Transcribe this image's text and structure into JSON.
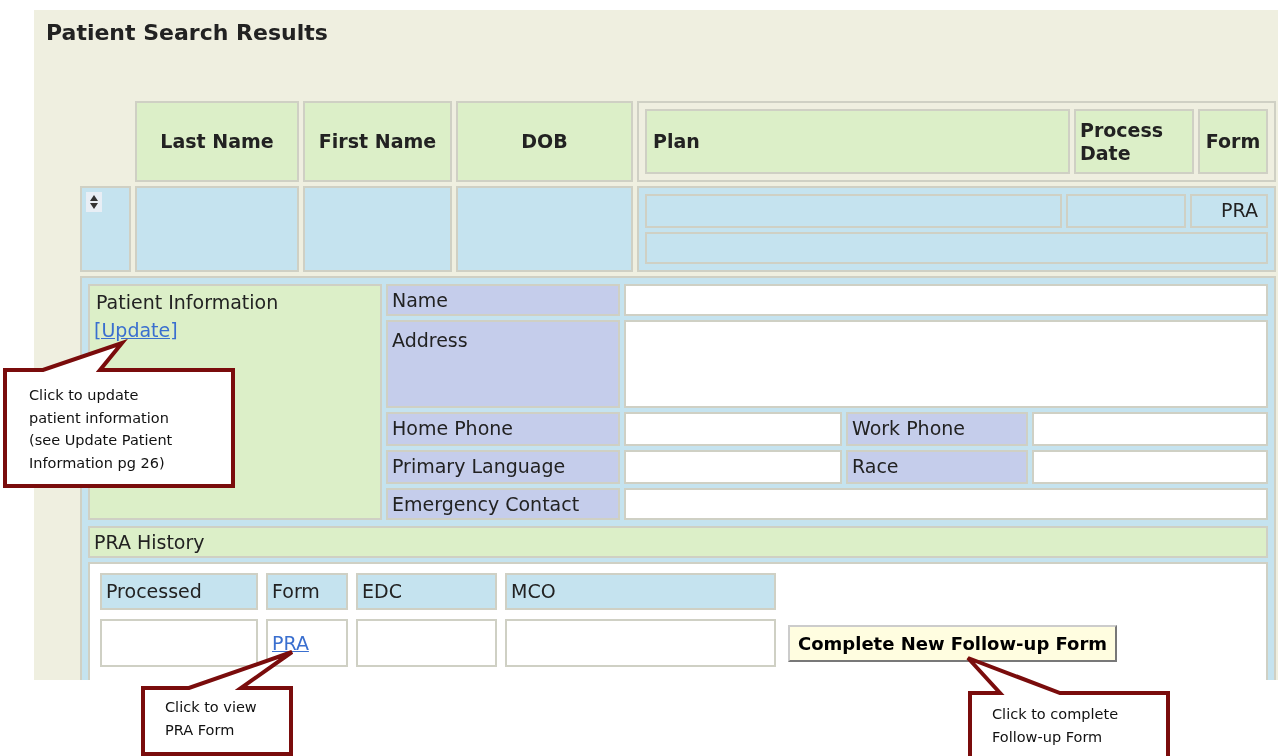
{
  "title": "Patient Search Results",
  "results_table": {
    "columns": [
      "Last Name",
      "First Name",
      "DOB"
    ],
    "plan_columns": [
      "Plan",
      "Process Date",
      "Form"
    ],
    "rows": [
      {
        "form": "PRA"
      }
    ]
  },
  "patient_panel": {
    "heading": "Patient Information",
    "update_link": "[Update]",
    "rows": [
      {
        "kind": "single",
        "labels": [
          "Name"
        ]
      },
      {
        "kind": "tall",
        "labels": [
          "Address"
        ]
      },
      {
        "kind": "pair",
        "labels": [
          "Home Phone",
          "Work Phone"
        ]
      },
      {
        "kind": "pair",
        "labels": [
          "Primary Language",
          "Race"
        ]
      },
      {
        "kind": "single",
        "labels": [
          "Emergency Contact"
        ]
      }
    ]
  },
  "history": {
    "heading": "PRA History",
    "columns": [
      "Processed",
      "Form",
      "EDC",
      "MCO"
    ],
    "rows": [
      {
        "form_link": "PRA"
      }
    ],
    "button": "Complete New Follow-up Form"
  },
  "callouts": [
    {
      "lines": [
        "Click to update",
        "patient information",
        "(see Update Patient",
        "Information pg 26)"
      ]
    },
    {
      "lines": [
        "Click to view",
        "PRA Form"
      ]
    },
    {
      "lines": [
        "Click to complete",
        "Follow-up Form"
      ]
    }
  ]
}
